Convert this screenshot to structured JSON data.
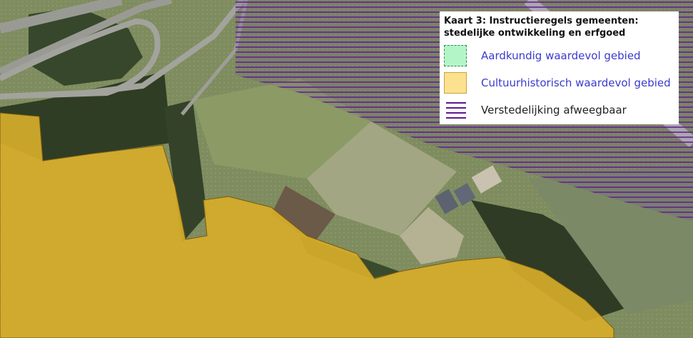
{
  "map": {
    "colors": {
      "aerial_field": "#7d8a5e",
      "aerial_forest": "#2f3d25",
      "road": "#9a9a95",
      "heritage_fill": "#d6ac2a",
      "urbanization_lines": "#5b1a8c"
    }
  },
  "legend": {
    "title": "Kaart 3: Instructieregels gemeenten: stedelijke ontwikkeling en erfgoed",
    "items": [
      {
        "label": "Aardkundig waardevol gebied",
        "swatch_color": "#b4f5c8",
        "text_color": "#3a3ad0"
      },
      {
        "label": "Cultuurhistorisch waardevol gebied",
        "swatch_color": "#fde18f",
        "text_color": "#3a3ad0"
      },
      {
        "label": "Verstedelijking afweegbaar",
        "swatch_color": "#5b1a8c",
        "text_color": "#222222"
      }
    ]
  }
}
